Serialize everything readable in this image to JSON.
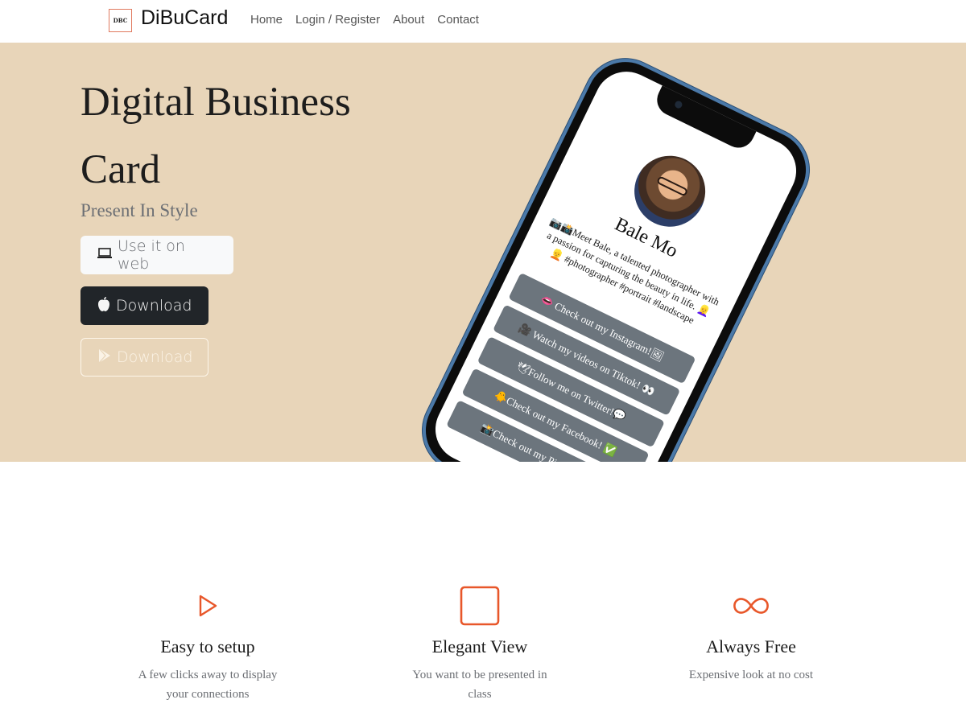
{
  "nav": {
    "logo_text": "DBC",
    "brand": "DiBuCard",
    "links": [
      "Home",
      "Login / Register",
      "About",
      "Contact"
    ]
  },
  "hero": {
    "title": "Digital Business Card",
    "subtitle": "Present In Style",
    "btn_web": "Use it on web",
    "btn_apple": "Download",
    "btn_play": "Download"
  },
  "card": {
    "name": "Bale Mo",
    "bio": "📷📸Meet Bale, a talented photographer with a passion for capturing the beauty in life. 👱‍♀️👱 #photographer #portrait #landscape",
    "links": [
      "👄 Check out my Instagram!🖼",
      "🎥 Watch my videos on Tiktok! 👀",
      "🕊Follow me on Twitter!💬",
      "🐥Check out my Facebook! ✅",
      "📸Check out my Pinterest! 🔔"
    ]
  },
  "features": [
    {
      "icon": "play-icon",
      "title": "Easy to setup",
      "desc": "A few clicks away to display your connections"
    },
    {
      "icon": "square-icon",
      "title": "Elegant View",
      "desc": "You want to be presented in class"
    },
    {
      "icon": "infinity-icon",
      "title": "Always Free",
      "desc": "Expensive look at no cost"
    }
  ],
  "colors": {
    "hero_bg": "#e8d5b9",
    "accent": "#e8572a",
    "dark_button": "#212529",
    "link_button": "#6c757d"
  }
}
